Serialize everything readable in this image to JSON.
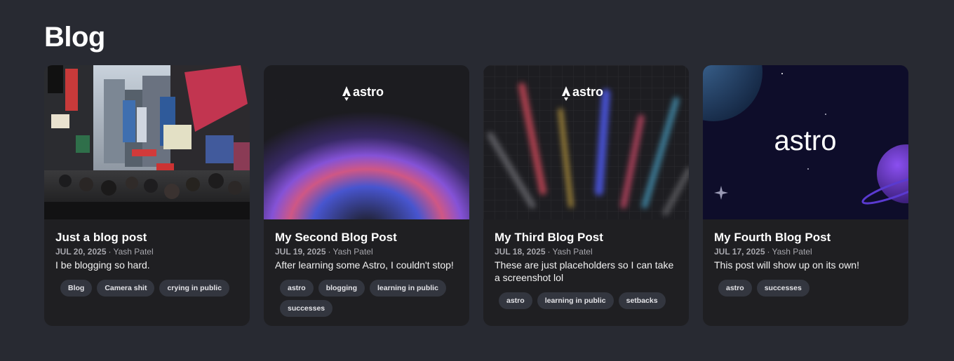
{
  "page": {
    "title": "Blog"
  },
  "posts": [
    {
      "image": "tokyo-street-photo",
      "title": "Just a blog post",
      "date": "JUL 20, 2025",
      "separator": "·",
      "author": "Yash Patel",
      "description": "I be blogging so hard.",
      "tags": [
        "Blog",
        "Camera shit",
        "crying in public"
      ]
    },
    {
      "image": "astro-gradient-arc",
      "logo_text": "astro",
      "title": "My Second Blog Post",
      "date": "JUL 19, 2025",
      "separator": "·",
      "author": "Yash Patel",
      "description": "After learning some Astro, I couldn't stop!",
      "tags": [
        "astro",
        "blogging",
        "learning in public",
        "successes"
      ]
    },
    {
      "image": "astro-light-rays",
      "logo_text": "astro",
      "title": "My Third Blog Post",
      "date": "JUL 18, 2025",
      "separator": "·",
      "author": "Yash Patel",
      "description": "These are just placeholders so I can take a screenshot lol",
      "tags": [
        "astro",
        "learning in public",
        "setbacks"
      ]
    },
    {
      "image": "astro-space-planets",
      "logo_text": "astro",
      "title": "My Fourth Blog Post",
      "date": "JUL 17, 2025",
      "separator": "·",
      "author": "Yash Patel",
      "description": "This post will show up on its own!",
      "tags": [
        "astro",
        "successes"
      ]
    }
  ]
}
